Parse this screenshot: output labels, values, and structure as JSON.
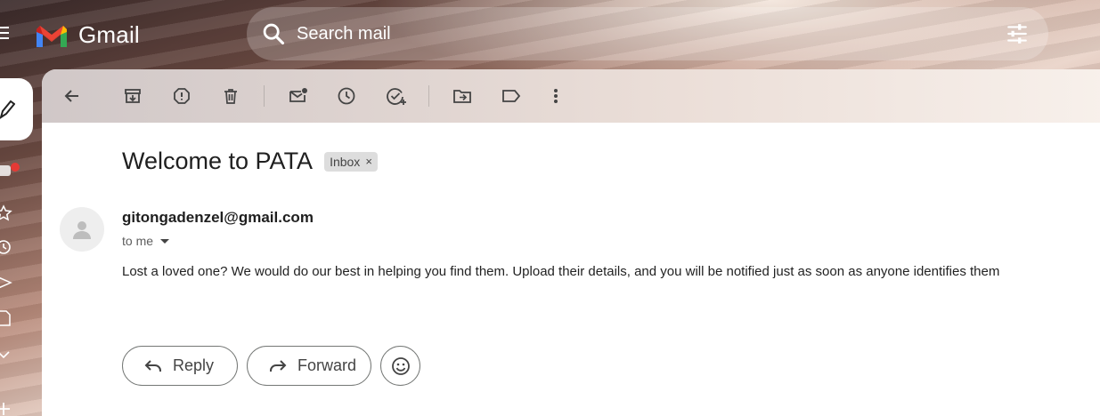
{
  "app": {
    "name": "Gmail"
  },
  "search": {
    "placeholder": "Search mail"
  },
  "toolbar": {
    "buttons": [
      "back-arrow-icon",
      "archive-icon",
      "report-spam-icon",
      "delete-icon",
      "mark-unread-icon",
      "snooze-icon",
      "add-to-tasks-icon",
      "move-to-icon",
      "labels-icon",
      "more-vert-icon"
    ]
  },
  "email": {
    "subject": "Welcome to PATA",
    "label": "Inbox",
    "label_remove": "×",
    "sender": "gitongadenzel@gmail.com",
    "to": "to me",
    "body": "Lost a loved one? We would do our best in helping you find them. Upload their details, and you will be notified just as soon as anyone identifies them"
  },
  "actions": {
    "reply": "Reply",
    "forward": "Forward"
  },
  "colors": {
    "gmail_red": "#EA4335",
    "gmail_blue": "#4285F4",
    "gmail_green": "#34A853",
    "gmail_yellow": "#FBBC04",
    "notification": "#E53935"
  }
}
